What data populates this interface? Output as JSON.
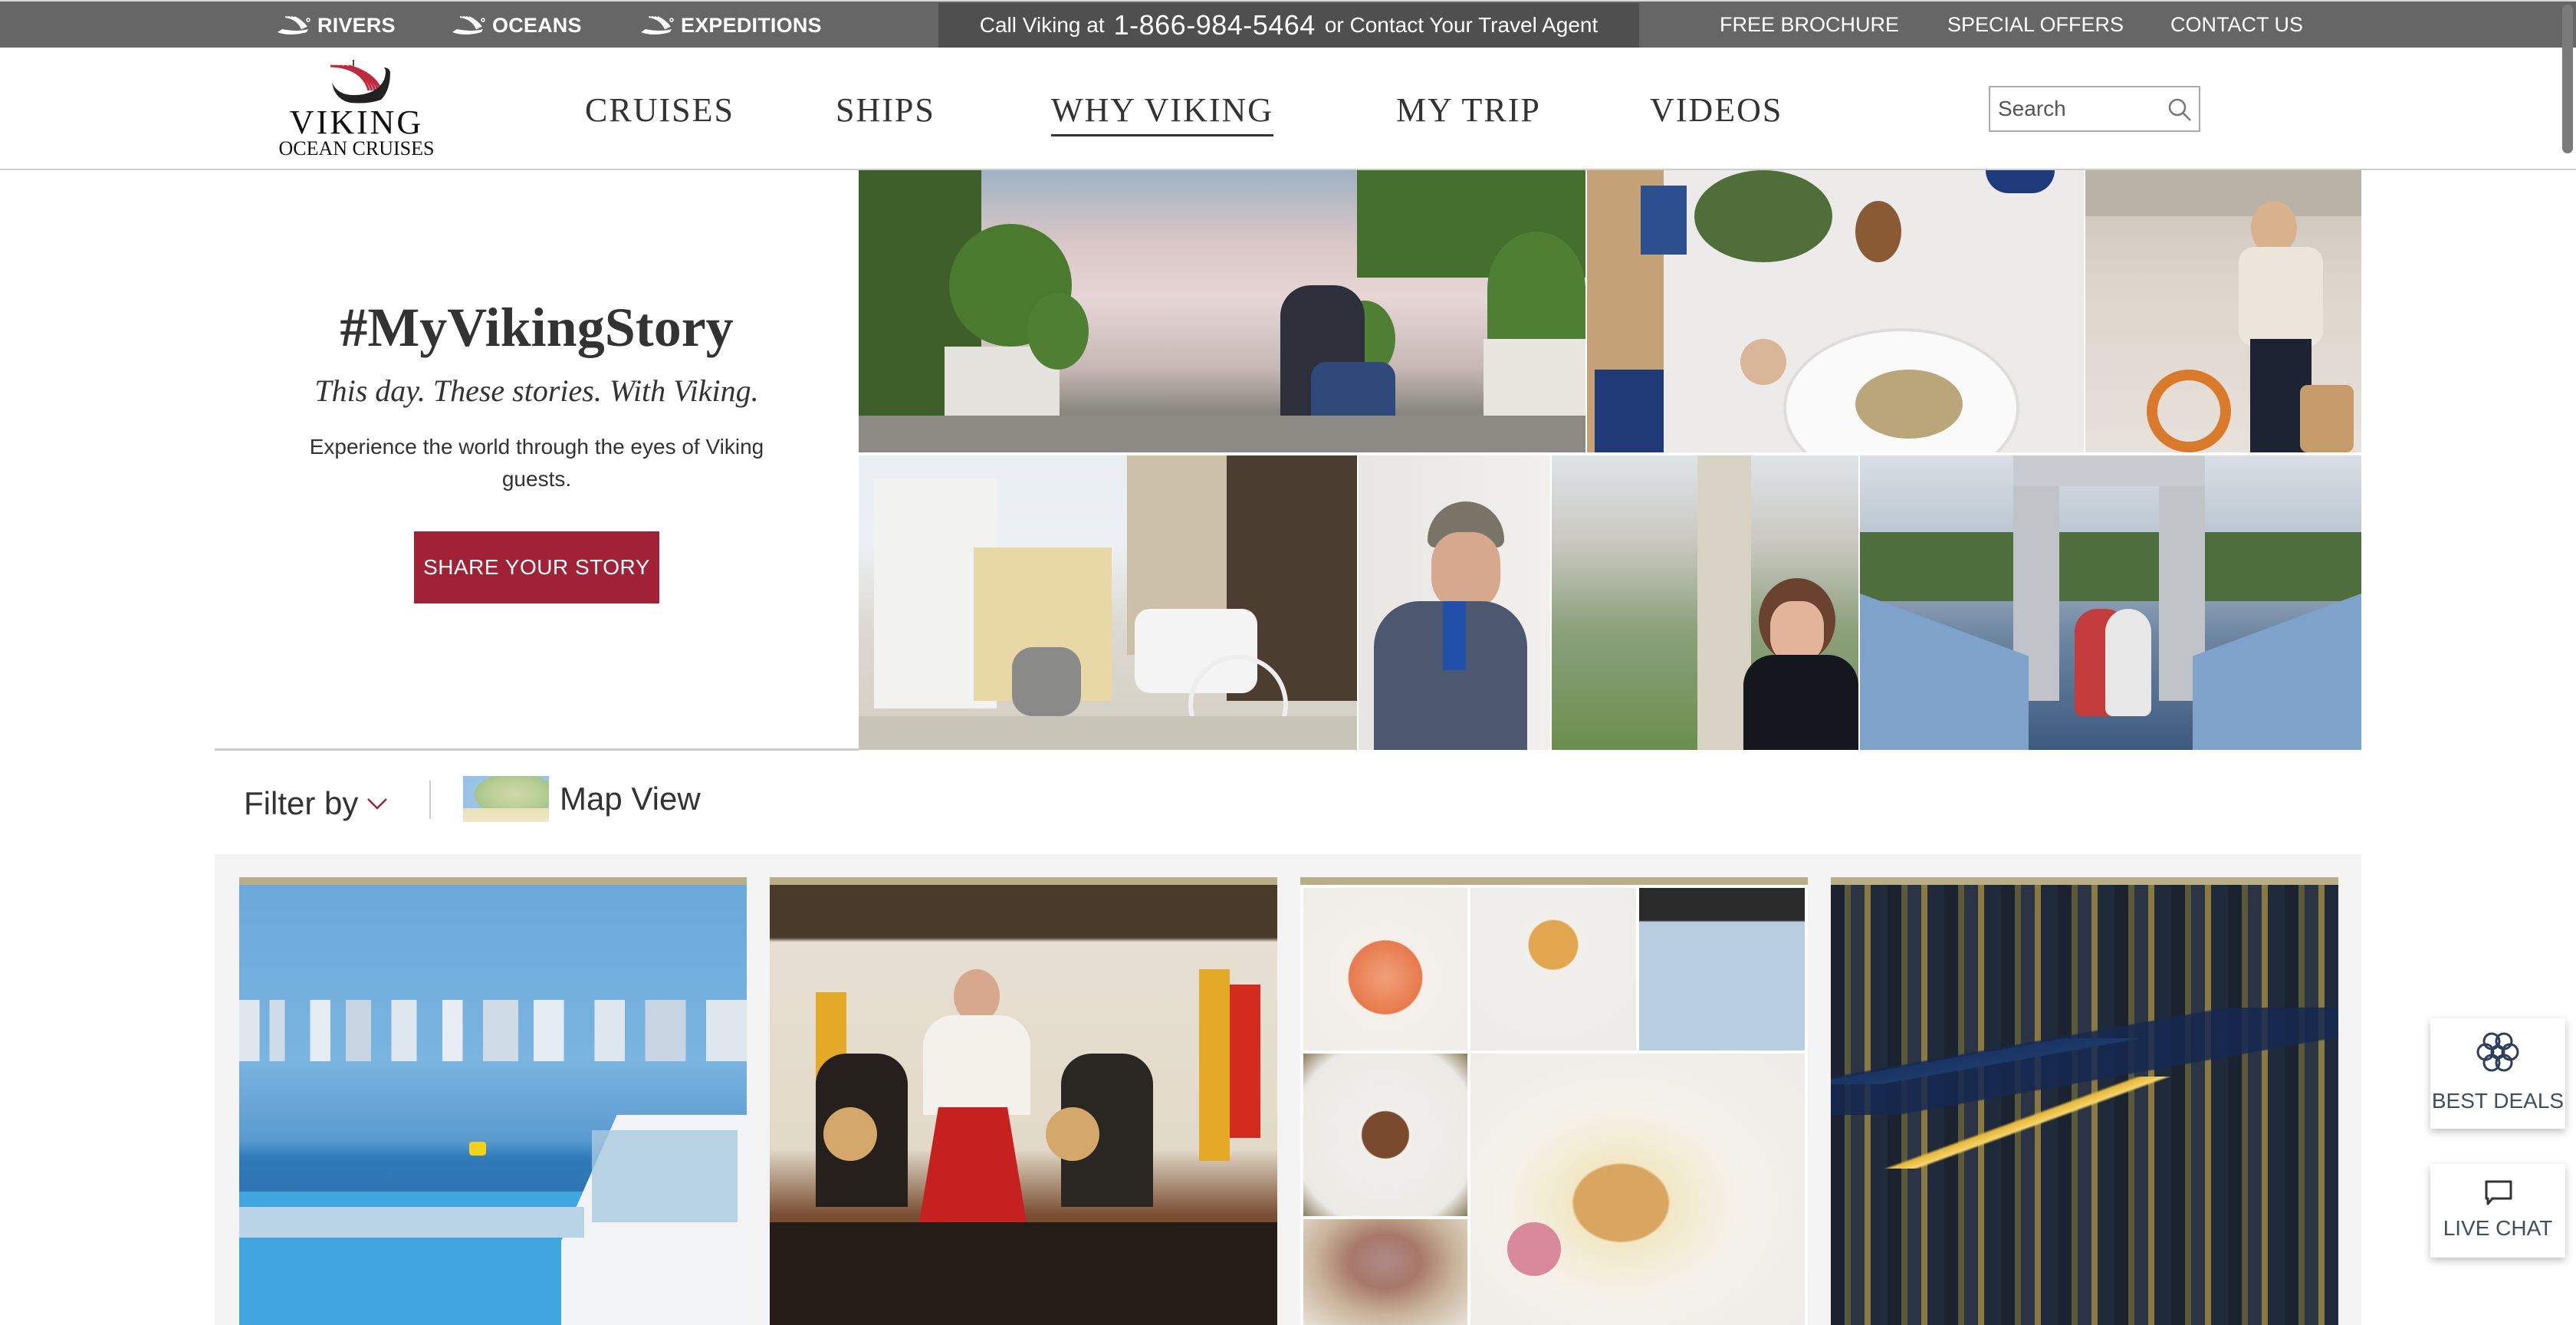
{
  "utility_bar": {
    "brands": [
      {
        "label": "RIVERS",
        "icon": "viking-ship-icon"
      },
      {
        "label": "OCEANS",
        "icon": "viking-ship-icon"
      },
      {
        "label": "EXPEDITIONS",
        "icon": "viking-ship-icon"
      }
    ],
    "call": {
      "prefix": "Call Viking at",
      "phone": "1-866-984-5464",
      "suffix": "or Contact Your Travel Agent"
    },
    "links": [
      "FREE BROCHURE",
      "SPECIAL OFFERS",
      "CONTACT US"
    ]
  },
  "header": {
    "logo": {
      "name": "VIKING",
      "sub": "OCEAN CRUISES"
    },
    "nav": [
      {
        "label": "CRUISES",
        "active": false
      },
      {
        "label": "SHIPS",
        "active": false
      },
      {
        "label": "WHY VIKING",
        "active": true
      },
      {
        "label": "MY TRIP",
        "active": false
      },
      {
        "label": "VIDEOS",
        "active": false
      }
    ],
    "search": {
      "placeholder": "Search",
      "value": ""
    }
  },
  "hero": {
    "title": "#MyVikingStory",
    "tagline": "This day. These stories. With Viking.",
    "description": "Experience the world through the eyes of Viking guests.",
    "cta": "SHARE YOUR STORY",
    "photos": [
      "woman-sitting-at-palace-garden",
      "table-with-food-overhead",
      "woman-on-ship-deck",
      "horse-carriage-in-city-square",
      "man-in-flat-cap",
      "woman-at-budapest-overlook",
      "couple-on-suspension-bridge"
    ]
  },
  "filter_bar": {
    "filter_label": "Filter by",
    "map_view_label": "Map View"
  },
  "cards": [
    {
      "subject": "city-skyline-from-ship-pool"
    },
    {
      "subject": "folk-music-performance"
    },
    {
      "subject": "food-collage"
    },
    {
      "subject": "city-at-night-aerial"
    }
  ],
  "widgets": {
    "best_deals": "BEST DEALS",
    "live_chat": "LIVE CHAT"
  },
  "colors": {
    "utility_bg": "#666666",
    "call_bg": "#4f4f4f",
    "accent_red": "#a12237",
    "card_cap": "#b8ae87",
    "panel_bg": "#f3f3f3",
    "widget_text": "#3d4f60"
  }
}
